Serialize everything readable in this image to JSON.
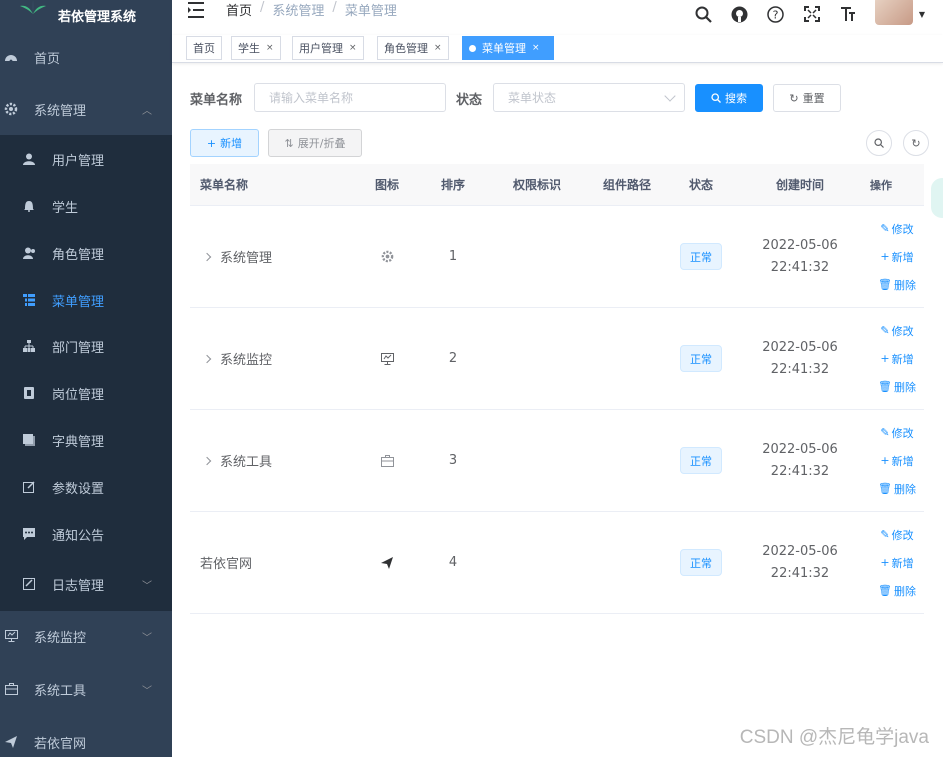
{
  "app": {
    "title": "若依管理系统"
  },
  "sidebar": {
    "items": [
      {
        "label": "首页",
        "icon": "dashboard-icon"
      },
      {
        "label": "系统管理",
        "icon": "gear-icon"
      },
      {
        "label": "用户管理",
        "icon": "user-icon"
      },
      {
        "label": "学生",
        "icon": "bell-icon"
      },
      {
        "label": "角色管理",
        "icon": "peoples-icon"
      },
      {
        "label": "菜单管理",
        "icon": "tree-table-icon"
      },
      {
        "label": "部门管理",
        "icon": "tree-icon"
      },
      {
        "label": "岗位管理",
        "icon": "post-icon"
      },
      {
        "label": "字典管理",
        "icon": "dict-icon"
      },
      {
        "label": "参数设置",
        "icon": "edit-icon"
      },
      {
        "label": "通知公告",
        "icon": "message-icon"
      },
      {
        "label": "日志管理",
        "icon": "log-icon"
      },
      {
        "label": "系统监控",
        "icon": "monitor-icon"
      },
      {
        "label": "系统工具",
        "icon": "tool-icon"
      },
      {
        "label": "若依官网",
        "icon": "guide-icon"
      }
    ]
  },
  "breadcrumb": {
    "items": [
      "首页",
      "系统管理",
      "菜单管理"
    ],
    "separator": "/"
  },
  "tags": [
    {
      "label": "首页"
    },
    {
      "label": "学生"
    },
    {
      "label": "用户管理"
    },
    {
      "label": "角色管理"
    },
    {
      "label": "菜单管理"
    }
  ],
  "search": {
    "name_label": "菜单名称",
    "name_placeholder": "请输入菜单名称",
    "status_label": "状态",
    "status_placeholder": "菜单状态",
    "search_button": "搜索",
    "reset_button": "重置"
  },
  "toolbar": {
    "add_button": "新增",
    "expand_button": "展开/折叠"
  },
  "table": {
    "headers": [
      "菜单名称",
      "图标",
      "排序",
      "权限标识",
      "组件路径",
      "状态",
      "创建时间",
      "操作"
    ],
    "rows": [
      {
        "name": "系统管理",
        "icon": "gear-icon",
        "sort": "1",
        "status": "正常",
        "date": "2022-05-06",
        "time": "22:41:32",
        "expandable": true
      },
      {
        "name": "系统监控",
        "icon": "monitor-icon",
        "sort": "2",
        "status": "正常",
        "date": "2022-05-06",
        "time": "22:41:32",
        "expandable": true
      },
      {
        "name": "系统工具",
        "icon": "tool-icon",
        "sort": "3",
        "status": "正常",
        "date": "2022-05-06",
        "time": "22:41:32",
        "expandable": true
      },
      {
        "name": "若依官网",
        "icon": "guide-icon",
        "sort": "4",
        "status": "正常",
        "date": "2022-05-06",
        "time": "22:41:32",
        "expandable": false
      }
    ],
    "ops": {
      "edit": "修改",
      "add": "新增",
      "delete": "删除"
    }
  },
  "watermark": "CSDN @杰尼龟学java",
  "colors": {
    "sidebar_bg": "#304156",
    "submenu_bg": "#1f2d3d",
    "primary": "#1890ff",
    "active_menu": "#409eff"
  }
}
